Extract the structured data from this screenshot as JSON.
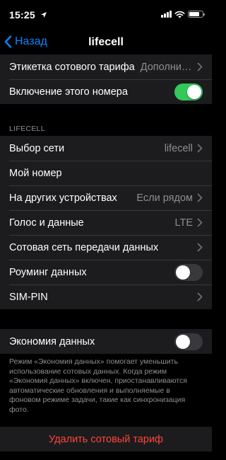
{
  "status_bar": {
    "time": "15:25",
    "signal_bars": 4,
    "battery_level": 0.85
  },
  "nav": {
    "back_label": "Назад",
    "title": "lifecell"
  },
  "group1": {
    "rows": [
      {
        "label": "Этикетка сотового тарифа",
        "value": "Дополните…"
      },
      {
        "label": "Включение этого номера",
        "toggle": "on"
      }
    ]
  },
  "section_header": "LIFECELL",
  "group2": {
    "rows": [
      {
        "label": "Выбор сети",
        "value": "lifecell"
      },
      {
        "label": "Мой номер"
      },
      {
        "label": "На других устройствах",
        "value": "Если рядом"
      },
      {
        "label": "Голос и данные",
        "value": "LTE"
      },
      {
        "label": "Сотовая сеть передачи данных"
      },
      {
        "label": "Роуминг данных",
        "toggle": "off"
      },
      {
        "label": "SIM-PIN"
      }
    ]
  },
  "group3": {
    "rows": [
      {
        "label": "Экономия данных",
        "toggle": "off"
      }
    ]
  },
  "footer_note": "Режим «Экономия данных» помогает уменьшить использование сотовых данных. Когда режим «Экономия данных» включен, приостанавливаются автоматические обновления и выполняемые в фоновом режиме задачи, такие как синхронизация фото.",
  "delete_label": "Удалить сотовый тариф",
  "colors": {
    "accent": "#0a84ff",
    "toggle_on": "#34c759",
    "destructive": "#ff453a",
    "secondary_text": "#8e8e93",
    "cell_bg": "#1c1c1e"
  },
  "icons": {
    "back": "chevron-left-icon",
    "disclosure": "chevron-right-icon",
    "location": "location-arrow-icon",
    "wifi": "wifi-icon",
    "battery": "battery-icon"
  }
}
